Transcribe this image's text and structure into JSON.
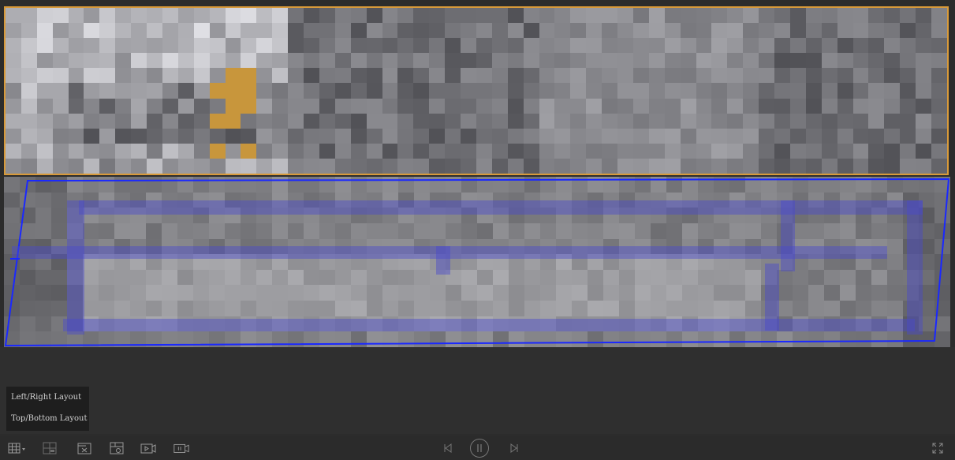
{
  "layout_menu": {
    "items": [
      {
        "label": "Left/Right Layout"
      },
      {
        "label": "Top/Bottom Layout"
      }
    ]
  },
  "toolbar": {
    "left_icons": [
      "grid-layout-icon",
      "split-layout-icon",
      "close-window-icon",
      "snapshot-icon",
      "play-clip-icon",
      "pause-clip-icon"
    ],
    "center_icons": [
      "previous-frame-icon",
      "pause-icon",
      "next-frame-icon"
    ],
    "right_icons": [
      "fullscreen-icon"
    ]
  },
  "colors": {
    "selected_border": "#d89a3a",
    "overlay_line": "#1a28ff",
    "background": "#2c2c2c",
    "icon": "#8a8a8a"
  }
}
